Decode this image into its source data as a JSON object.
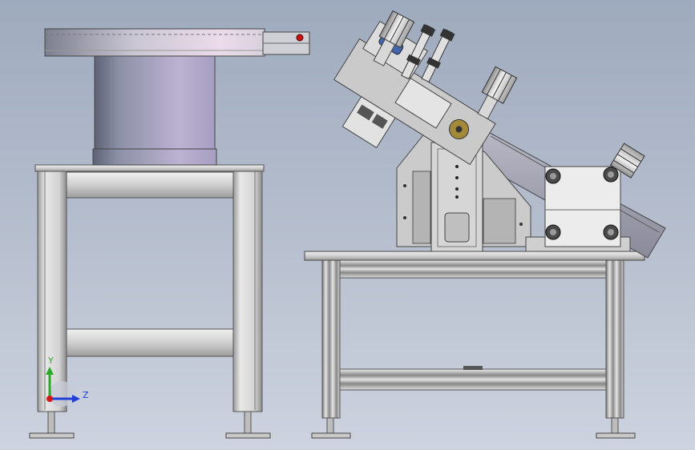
{
  "view": {
    "background_top": "#9eaabd",
    "background_bottom": "#cdd3df"
  },
  "colors": {
    "steel": "#d8d8d8",
    "steel_dark": "#8a8a8a",
    "drum": "#8d93ac",
    "plate": "#c8c8c8",
    "black": "#1a1a1a",
    "marker_red": "#cc1111"
  },
  "triad": {
    "y_label": "Y",
    "z_label": "Z",
    "y_color": "#2aa82a",
    "z_color": "#1f3fd6",
    "x_color": "#d01818"
  }
}
